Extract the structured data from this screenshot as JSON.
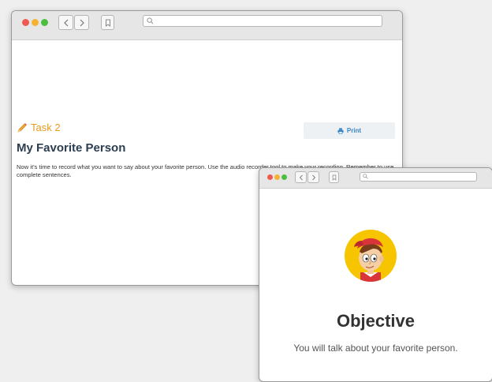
{
  "main_window": {
    "task_label": "Task 2",
    "print_label": "Print",
    "title": "My Favorite Person",
    "body": "Now it's time to record what you want to say about your favorite person. Use the audio recorder tool to make your recording. Remember to use complete sentences."
  },
  "popup_window": {
    "heading": "Objective",
    "subtext": "You will talk about your favorite person."
  },
  "colors": {
    "close_dot": "#ee5a52",
    "minimize_dot": "#f5b231",
    "maximize_dot": "#4dbd42",
    "task_orange": "#e89a1c",
    "print_blue": "#3a86c8",
    "avatar_bg": "#f7c500"
  },
  "icons": [
    "pencil-icon",
    "printer-icon",
    "bookmark-icon",
    "search-icon",
    "chevron-left-icon",
    "chevron-right-icon"
  ]
}
